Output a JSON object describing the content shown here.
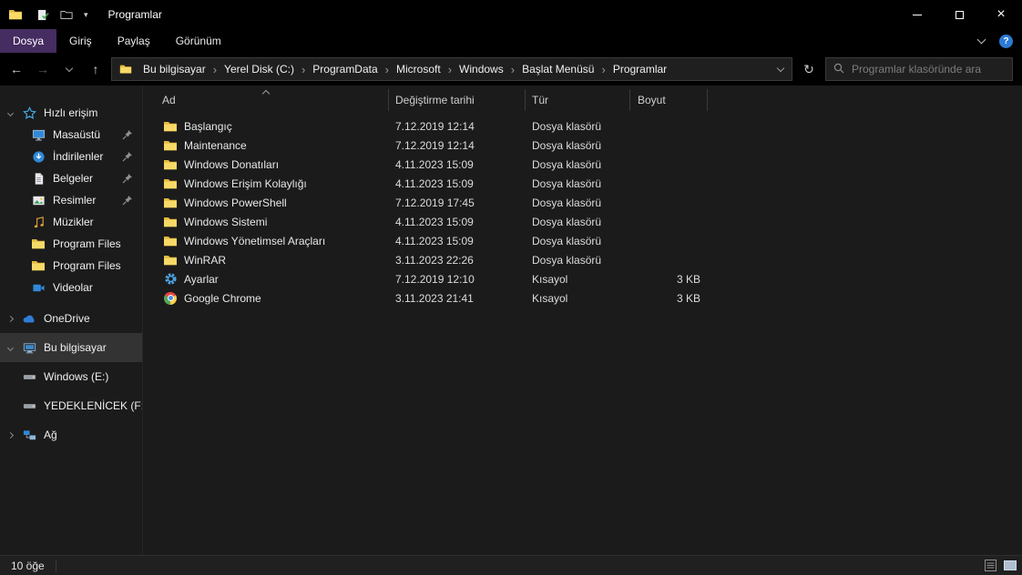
{
  "colors": {
    "titlebar_bg": "#000000",
    "file_tab_bg": "#452c61",
    "content_bg": "#1b1b1b",
    "selection_bg": "#333333",
    "folder_yellow": "#f7d967",
    "help_blue": "#2b7bd6"
  },
  "icons": {
    "back": "←",
    "forward": "→",
    "up": "↑",
    "refresh": "↻",
    "crumb_separator": "›",
    "help": "?",
    "qat_chevron": "▾",
    "close": "×"
  },
  "titlebar": {
    "title": "Programlar",
    "qat_icons": [
      "app-folder-icon",
      "qat-properties-icon",
      "qat-new-folder-icon",
      "qat-customize-chevron-icon"
    ],
    "controls": [
      "minimize-button",
      "maximize-button",
      "close-button"
    ]
  },
  "ribbon": {
    "tabs": [
      {
        "label": "Dosya",
        "active": true
      },
      {
        "label": "Giriş",
        "active": false
      },
      {
        "label": "Paylaş",
        "active": false
      },
      {
        "label": "Görünüm",
        "active": false
      }
    ]
  },
  "navbar": {
    "breadcrumbs": [
      "Bu bilgisayar",
      "Yerel Disk (C:)",
      "ProgramData",
      "Microsoft",
      "Windows",
      "Başlat Menüsü",
      "Programlar"
    ],
    "search": {
      "placeholder": "Programlar klasöründe ara",
      "value": ""
    }
  },
  "sidebar": {
    "items": [
      {
        "id": "quick-access",
        "label": "Hızlı erişim",
        "icon": "star-icon",
        "level": 0,
        "expand": "open",
        "pinned": false,
        "selected": false,
        "group": false
      },
      {
        "id": "desktop",
        "label": "Masaüstü",
        "icon": "desktop-icon",
        "level": 1,
        "pinned": true
      },
      {
        "id": "downloads",
        "label": "İndirilenler",
        "icon": "downloads-icon",
        "level": 1,
        "pinned": true
      },
      {
        "id": "documents",
        "label": "Belgeler",
        "icon": "documents-icon",
        "level": 1,
        "pinned": true
      },
      {
        "id": "pictures",
        "label": "Resimler",
        "icon": "pictures-icon",
        "level": 1,
        "pinned": true
      },
      {
        "id": "music",
        "label": "Müzikler",
        "icon": "music-icon",
        "level": 1
      },
      {
        "id": "program-files-1",
        "label": "Program Files",
        "icon": "folder-icon",
        "level": 1
      },
      {
        "id": "program-files-2",
        "label": "Program Files",
        "icon": "folder-icon",
        "level": 1
      },
      {
        "id": "videos",
        "label": "Videolar",
        "icon": "videos-icon",
        "level": 1
      },
      {
        "id": "onedrive",
        "label": "OneDrive",
        "icon": "onedrive-icon",
        "level": 0,
        "expand": "closed",
        "group": true,
        "sep": true
      },
      {
        "id": "this-pc",
        "label": "Bu bilgisayar",
        "icon": "computer-icon",
        "level": 0,
        "expand": "open",
        "group": true,
        "selected": true
      },
      {
        "id": "drive-e",
        "label": "Windows (E:)",
        "icon": "drive-icon",
        "level": 0,
        "group": true
      },
      {
        "id": "drive-f",
        "label": "YEDEKLENİCEK (F:)",
        "icon": "drive-icon",
        "level": 0,
        "group": true
      },
      {
        "id": "network",
        "label": "Ağ",
        "icon": "network-icon",
        "level": 0,
        "expand": "closed",
        "group": true
      }
    ]
  },
  "filelist": {
    "sort_column": "Ad",
    "sort_ascending": true,
    "columns": [
      {
        "label": "Ad"
      },
      {
        "label": "Değiştirme tarihi"
      },
      {
        "label": "Tür"
      },
      {
        "label": "Boyut"
      }
    ],
    "rows": [
      {
        "icon": "folder-icon",
        "name": "Başlangıç",
        "date": "7.12.2019 12:14",
        "type": "Dosya klasörü",
        "size": ""
      },
      {
        "icon": "folder-icon",
        "name": "Maintenance",
        "date": "7.12.2019 12:14",
        "type": "Dosya klasörü",
        "size": ""
      },
      {
        "icon": "folder-icon",
        "name": "Windows Donatıları",
        "date": "4.11.2023 15:09",
        "type": "Dosya klasörü",
        "size": ""
      },
      {
        "icon": "folder-icon",
        "name": "Windows Erişim Kolaylığı",
        "date": "4.11.2023 15:09",
        "type": "Dosya klasörü",
        "size": ""
      },
      {
        "icon": "folder-icon",
        "name": "Windows PowerShell",
        "date": "7.12.2019 17:45",
        "type": "Dosya klasörü",
        "size": ""
      },
      {
        "icon": "folder-icon",
        "name": "Windows Sistemi",
        "date": "4.11.2023 15:09",
        "type": "Dosya klasörü",
        "size": ""
      },
      {
        "icon": "folder-icon",
        "name": "Windows Yönetimsel Araçları",
        "date": "4.11.2023 15:09",
        "type": "Dosya klasörü",
        "size": ""
      },
      {
        "icon": "folder-icon",
        "name": "WinRAR",
        "date": "3.11.2023 22:26",
        "type": "Dosya klasörü",
        "size": ""
      },
      {
        "icon": "settings-icon",
        "name": "Ayarlar",
        "date": "7.12.2019 12:10",
        "type": "Kısayol",
        "size": "3 KB"
      },
      {
        "icon": "chrome-icon",
        "name": "Google Chrome",
        "date": "3.11.2023 21:41",
        "type": "Kısayol",
        "size": "3 KB"
      }
    ]
  },
  "statusbar": {
    "item_count": "10 öğe",
    "view_buttons": [
      "details-view-icon",
      "large-icons-view-icon"
    ]
  }
}
